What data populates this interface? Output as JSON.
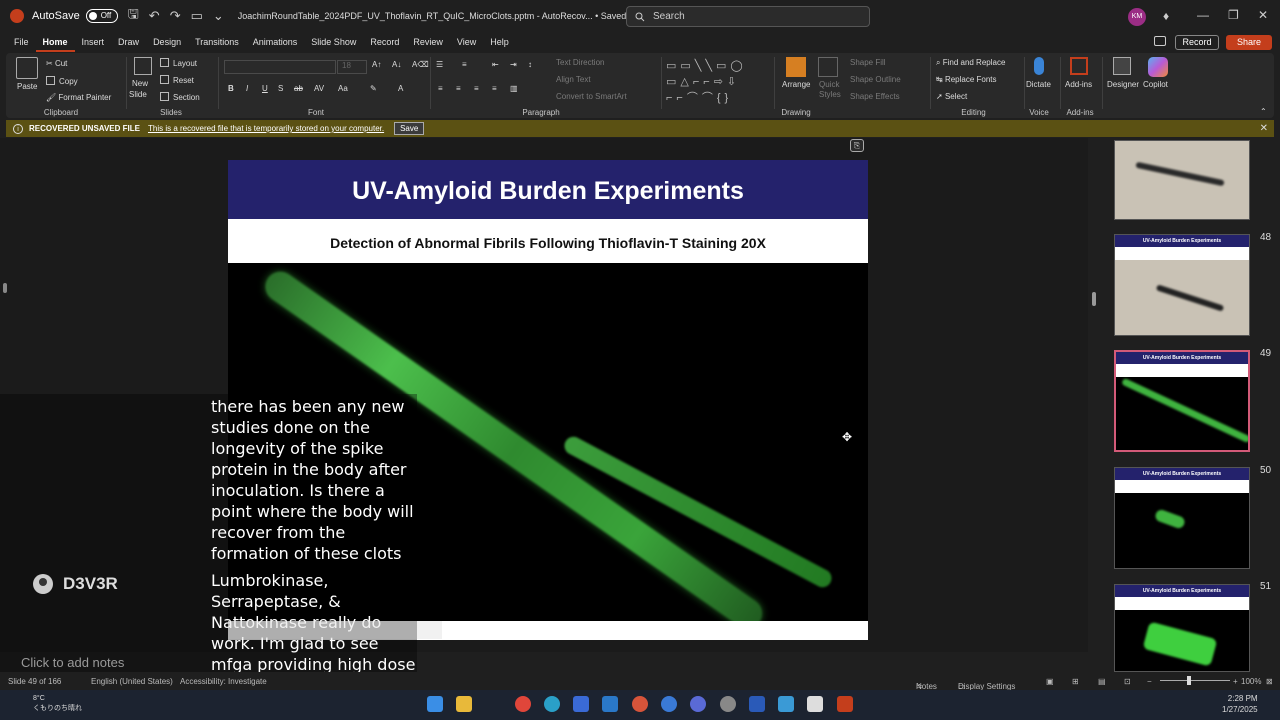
{
  "titlebar": {
    "autosave_label": "AutoSave",
    "autosave_state": "Off",
    "doc_title": "JoachimRoundTable_2024PDF_UV_Thoflavin_RT_QuIC_MicroClots.pptm  -  AutoRecov...  •  Saved to this PC",
    "search_placeholder": "Search",
    "avatar_initials": "KM"
  },
  "menu": {
    "tabs": [
      "File",
      "Home",
      "Insert",
      "Draw",
      "Design",
      "Transitions",
      "Animations",
      "Slide Show",
      "Record",
      "Review",
      "View",
      "Help"
    ],
    "record_label": "Record",
    "share_label": "Share"
  },
  "ribbon": {
    "clipboard": {
      "paste": "Paste",
      "cut": "Cut",
      "copy": "Copy",
      "format_painter": "Format Painter",
      "label": "Clipboard"
    },
    "slides": {
      "new_slide": "New",
      "new_slide2": "Slide",
      "layout": "Layout",
      "reset": "Reset",
      "section": "Section",
      "label": "Slides"
    },
    "font": {
      "size": "18",
      "label": "Font"
    },
    "paragraph": {
      "text_direction": "Text Direction",
      "align_text": "Align Text",
      "smartart": "Convert to SmartArt",
      "label": "Paragraph"
    },
    "drawing": {
      "arrange": "Arrange",
      "quick_styles": "Quick",
      "quick_styles2": "Styles",
      "shape_fill": "Shape Fill",
      "shape_outline": "Shape Outline",
      "shape_effects": "Shape Effects",
      "label": "Drawing"
    },
    "editing": {
      "find_replace": "Find and Replace",
      "replace_fonts": "Replace Fonts",
      "select": "Select",
      "label": "Editing"
    },
    "voice": {
      "dictate": "Dictate",
      "label": "Voice"
    },
    "addins": {
      "addins": "Add-ins",
      "label": "Add-ins",
      "designer": "Designer",
      "copilot": "Copilot"
    }
  },
  "infobar": {
    "title": "RECOVERED UNSAVED FILE",
    "text": "This is a recovered file that is temporarily stored on your computer.",
    "save_label": "Save"
  },
  "slide": {
    "title": "UV-Amyloid Burden Experiments",
    "subtitle": "Detection of Abnormal Fibrils Following Thioflavin-T Staining 20X"
  },
  "thumbnails": [
    {
      "num": "48"
    },
    {
      "num": "49"
    },
    {
      "num": "50"
    },
    {
      "num": "51"
    }
  ],
  "thumb_title": "UV-Amyloid Burden Experiments",
  "caption": {
    "lines1": "there has been any new studies done on the longevity of the spike protein in the body after inoculation. Is there a point where the body will recover from the formation of these clots",
    "lines2": "Lumbrokinase, Serrapeptase, & Nattokinase really do work. I'm glad to see mfga providing high dose versions of these now.",
    "channel": "D3V3R"
  },
  "notes_placeholder": "Click to add notes",
  "statusbar": {
    "slide_count": "Slide 49 of 166",
    "language": "English (United States)",
    "accessibility": "Accessibility: Investigate",
    "notes": "Notes",
    "display_settings": "Display Settings",
    "zoom": "100%"
  },
  "taskbar": {
    "temp": "8°C",
    "weather": "くもりのち晴れ",
    "time": "2:28 PM",
    "date": "1/27/2025"
  }
}
